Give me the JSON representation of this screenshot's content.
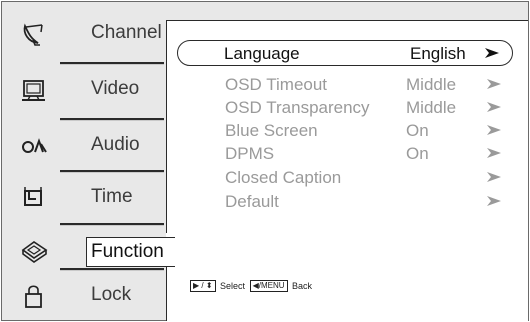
{
  "sidebar": {
    "items": [
      {
        "label": "Channel",
        "icon": "satellite-dish-icon",
        "active": false
      },
      {
        "label": "Video",
        "icon": "monitor-icon",
        "active": false
      },
      {
        "label": "Audio",
        "icon": "audio-icon",
        "active": false
      },
      {
        "label": "Time",
        "icon": "clock-icon",
        "active": false
      },
      {
        "label": "Function",
        "icon": "function-icon",
        "active": true
      },
      {
        "label": "Lock",
        "icon": "lock-icon",
        "active": false
      }
    ]
  },
  "menu": {
    "rows": [
      {
        "label": "Language",
        "value": "English",
        "selected": true
      },
      {
        "label": "OSD Timeout",
        "value": "Middle",
        "selected": false
      },
      {
        "label": "OSD Transparency",
        "value": "Middle",
        "selected": false
      },
      {
        "label": "Blue Screen",
        "value": "On",
        "selected": false
      },
      {
        "label": "DPMS",
        "value": "On",
        "selected": false
      },
      {
        "label": "Closed Caption",
        "value": "",
        "selected": false
      },
      {
        "label": "Default",
        "value": "",
        "selected": false
      }
    ]
  },
  "footer": {
    "select_key": "▶ / ⬍",
    "select_label": "Select",
    "back_key": "◀/MENU",
    "back_label": "Back"
  },
  "colors": {
    "frame_bg": "#e8e8e8",
    "panel_bg": "#ffffff",
    "active_text": "#111111",
    "inactive_text": "#9a9a9a",
    "sidebar_text": "#3c3c3c",
    "rule": "#2a2a2a"
  }
}
